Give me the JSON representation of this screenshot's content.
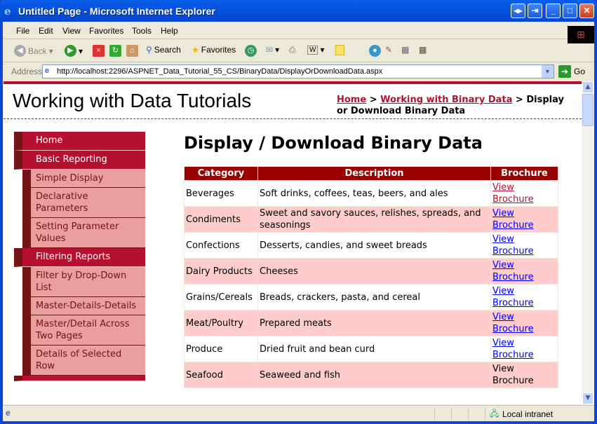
{
  "window": {
    "title": "Untitled Page - Microsoft Internet Explorer"
  },
  "menubar": [
    "File",
    "Edit",
    "View",
    "Favorites",
    "Tools",
    "Help"
  ],
  "toolbar": {
    "back": "Back",
    "search": "Search",
    "favorites": "Favorites"
  },
  "address": {
    "label": "Address",
    "url": "http://localhost:2296/ASPNET_Data_Tutorial_55_CS/BinaryData/DisplayOrDownloadData.aspx",
    "go": "Go"
  },
  "header": {
    "title": "Working with Data Tutorials",
    "breadcrumb": {
      "home": "Home",
      "sep": ">",
      "section": "Working with Binary Data",
      "current": "Display or Download Binary Data"
    }
  },
  "sidebar": [
    {
      "label": "Home",
      "level": 0
    },
    {
      "label": "Basic Reporting",
      "level": 0
    },
    {
      "label": "Simple Display",
      "level": 1
    },
    {
      "label": "Declarative Parameters",
      "level": 1
    },
    {
      "label": "Setting Parameter Values",
      "level": 1
    },
    {
      "label": "Filtering Reports",
      "level": 0
    },
    {
      "label": "Filter by Drop-Down List",
      "level": 1
    },
    {
      "label": "Master-Details-Details",
      "level": 1
    },
    {
      "label": "Master/Detail Across Two Pages",
      "level": 1
    },
    {
      "label": "Details of Selected Row",
      "level": 1
    }
  ],
  "main": {
    "heading": "Display / Download Binary Data",
    "columns": [
      "Category",
      "Description",
      "Brochure"
    ],
    "rows": [
      {
        "category": "Beverages",
        "description": "Soft drinks, coffees, teas, beers, and ales",
        "brochure": "View Brochure",
        "link": "visited"
      },
      {
        "category": "Condiments",
        "description": "Sweet and savory sauces, relishes, spreads, and seasonings",
        "brochure": "View Brochure",
        "link": "link"
      },
      {
        "category": "Confections",
        "description": "Desserts, candies, and sweet breads",
        "brochure": "View Brochure",
        "link": "link"
      },
      {
        "category": "Dairy Products",
        "description": "Cheeses",
        "brochure": "View Brochure",
        "link": "link"
      },
      {
        "category": "Grains/Cereals",
        "description": "Breads, crackers, pasta, and cereal",
        "brochure": "View Brochure",
        "link": "link"
      },
      {
        "category": "Meat/Poultry",
        "description": "Prepared meats",
        "brochure": "View Brochure",
        "link": "link"
      },
      {
        "category": "Produce",
        "description": "Dried fruit and bean curd",
        "brochure": "View Brochure",
        "link": "link"
      },
      {
        "category": "Seafood",
        "description": "Seaweed and fish",
        "brochure": "View Brochure",
        "link": "none"
      }
    ]
  },
  "status": {
    "zone": "Local intranet"
  },
  "colors": {
    "accent": "#b5112f",
    "dark": "#731416",
    "submenu": "#eb9e9e",
    "header": "#990000",
    "altrow": "#ffcccc"
  }
}
